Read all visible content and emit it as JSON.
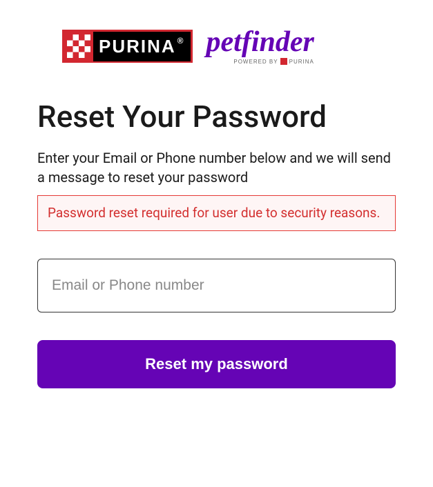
{
  "logos": {
    "purina": "PURINA",
    "petfinder": "petfinder",
    "petfinder_sub": "POWERED BY",
    "petfinder_sub_brand": "PURINA"
  },
  "heading": "Reset Your Password",
  "description": "Enter your Email or Phone number below and we will send a message to reset your password",
  "error": "Password reset required for user due to security reasons.",
  "input": {
    "placeholder": "Email or Phone number",
    "value": ""
  },
  "button": "Reset my password"
}
